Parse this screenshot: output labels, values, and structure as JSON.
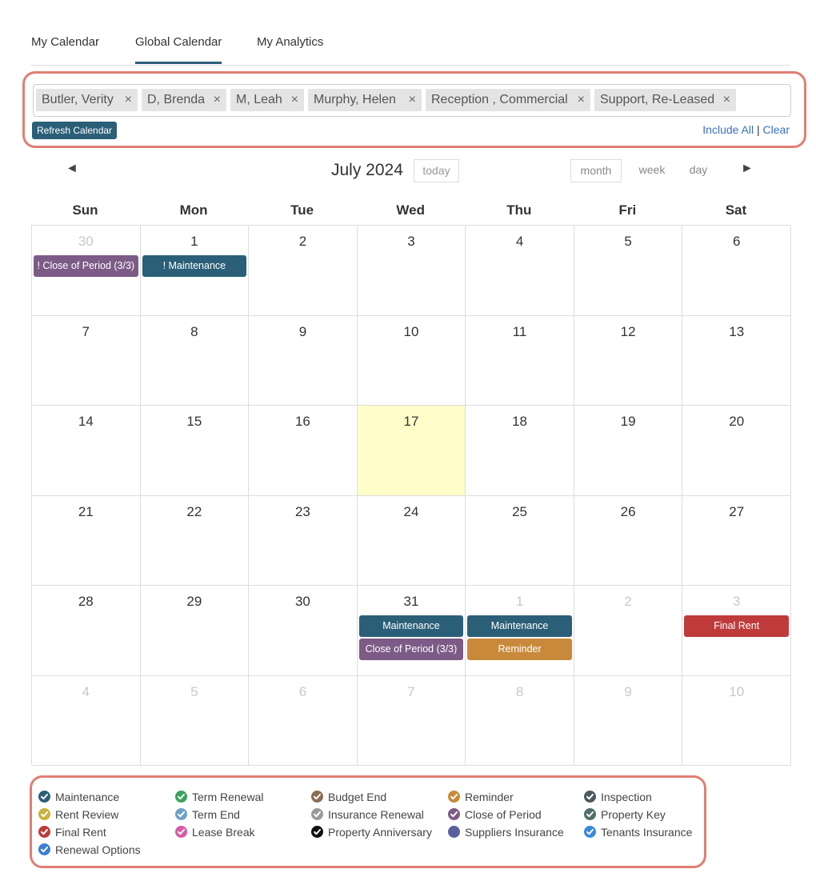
{
  "tabs": [
    {
      "label": "My Calendar"
    },
    {
      "label": "Global Calendar",
      "active": true
    },
    {
      "label": "My Analytics"
    }
  ],
  "filter": {
    "chips": [
      {
        "label": "Butler, Verity"
      },
      {
        "label": "D, Brenda"
      },
      {
        "label": "M, Leah"
      },
      {
        "label": "Murphy, Helen"
      },
      {
        "label": "Reception , Commercial"
      },
      {
        "label": "Support, Re-Leased"
      }
    ],
    "remove_glyph": "×",
    "refresh_label": "Refresh Calendar",
    "include_all_label": "Include All",
    "separator": "|",
    "clear_label": "Clear"
  },
  "calendar": {
    "title": "July 2024",
    "prev_icon": "◄",
    "next_icon": "►",
    "today_label": "today",
    "views": {
      "month": "month",
      "week": "week",
      "day": "day"
    },
    "weekdays": [
      "Sun",
      "Mon",
      "Tue",
      "Wed",
      "Thu",
      "Fri",
      "Sat"
    ],
    "weeks": [
      [
        "30",
        "1",
        "2",
        "3",
        "4",
        "5",
        "6"
      ],
      [
        "7",
        "8",
        "9",
        "10",
        "11",
        "12",
        "13"
      ],
      [
        "14",
        "15",
        "16",
        "17",
        "18",
        "19",
        "20"
      ],
      [
        "21",
        "22",
        "23",
        "24",
        "25",
        "26",
        "27"
      ],
      [
        "28",
        "29",
        "30",
        "31",
        "1",
        "2",
        "3"
      ],
      [
        "4",
        "5",
        "6",
        "7",
        "8",
        "9",
        "10"
      ]
    ],
    "today_date": "17",
    "events": {
      "w0d0": [
        {
          "label": "! Close of Period (3/3)",
          "type": "close"
        }
      ],
      "w0d1": [
        {
          "label": "! Maintenance",
          "type": "maint"
        }
      ],
      "w4d3": [
        {
          "label": "Maintenance",
          "type": "maint"
        },
        {
          "label": "Close of Period (3/3)",
          "type": "close"
        }
      ],
      "w4d4": [
        {
          "label": "Maintenance",
          "type": "maint"
        },
        {
          "label": "Reminder",
          "type": "reminder"
        }
      ],
      "w4d6": [
        {
          "label": "Final Rent",
          "type": "finalrent"
        }
      ]
    }
  },
  "legend": [
    {
      "label": "Maintenance",
      "color": "#2b5f77",
      "icon": "check-circle-icon"
    },
    {
      "label": "Term Renewal",
      "color": "#3aa35a",
      "icon": "check-circle-icon"
    },
    {
      "label": "Budget End",
      "color": "#8a6d52",
      "icon": "check-circle-icon"
    },
    {
      "label": "Reminder",
      "color": "#c88a3a",
      "icon": "check-circle-icon"
    },
    {
      "label": "Inspection",
      "color": "#4a5a5e",
      "icon": "check-circle-icon"
    },
    {
      "label": "Rent Review",
      "color": "#c9b13a",
      "icon": "check-circle-icon"
    },
    {
      "label": "Term End",
      "color": "#6fa0c8",
      "icon": "check-circle-icon"
    },
    {
      "label": "Insurance Renewal",
      "color": "#9a9a9a",
      "icon": "check-circle-icon"
    },
    {
      "label": "Close of Period",
      "color": "#7c5b86",
      "icon": "check-circle-icon"
    },
    {
      "label": "Property Key",
      "color": "#4f6f6a",
      "icon": "check-circle-icon"
    },
    {
      "label": "Final Rent",
      "color": "#bf3b3b",
      "icon": "check-circle-icon"
    },
    {
      "label": "Lease Break",
      "color": "#d95aa3",
      "icon": "check-circle-icon"
    },
    {
      "label": "Property Anniversary",
      "color": "#111111",
      "icon": "check-circle-icon"
    },
    {
      "label": "Suppliers Insurance",
      "color": "#5a5f9e",
      "icon": "dot-icon"
    },
    {
      "label": "Tenants Insurance",
      "color": "#3a8ad6",
      "icon": "check-circle-icon"
    },
    {
      "label": "Renewal Options",
      "color": "#3a7fd0",
      "icon": "check-circle-icon"
    }
  ]
}
